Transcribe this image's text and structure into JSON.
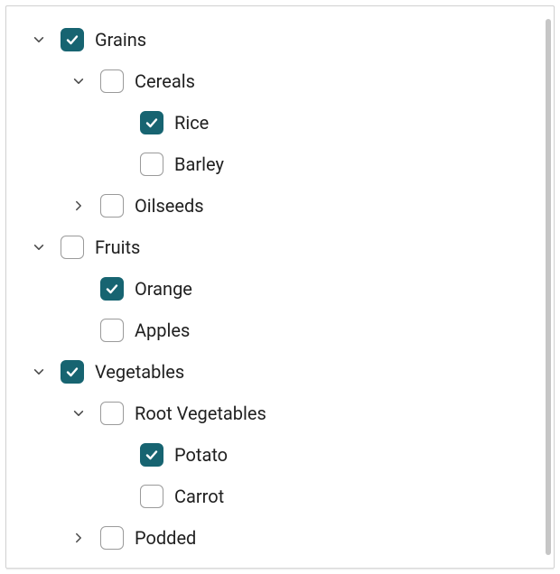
{
  "colors": {
    "accent": "#176471",
    "border": "#d0d0d0",
    "checkbox_border": "#9a9a9a"
  },
  "tree": [
    {
      "id": "grains",
      "label": "Grains",
      "checked": true,
      "expanded": true,
      "children": [
        {
          "id": "cereals",
          "label": "Cereals",
          "checked": false,
          "expanded": true,
          "children": [
            {
              "id": "rice",
              "label": "Rice",
              "checked": true
            },
            {
              "id": "barley",
              "label": "Barley",
              "checked": false
            }
          ]
        },
        {
          "id": "oilseeds",
          "label": "Oilseeds",
          "checked": false,
          "expanded": false,
          "children": []
        }
      ]
    },
    {
      "id": "fruits",
      "label": "Fruits",
      "checked": false,
      "expanded": true,
      "children": [
        {
          "id": "orange",
          "label": "Orange",
          "checked": true
        },
        {
          "id": "apples",
          "label": "Apples",
          "checked": false
        }
      ]
    },
    {
      "id": "vegetables",
      "label": "Vegetables",
      "checked": true,
      "expanded": true,
      "children": [
        {
          "id": "root-vegetables",
          "label": "Root Vegetables",
          "checked": false,
          "expanded": true,
          "children": [
            {
              "id": "potato",
              "label": "Potato",
              "checked": true
            },
            {
              "id": "carrot",
              "label": "Carrot",
              "checked": false
            }
          ]
        },
        {
          "id": "podded",
          "label": "Podded",
          "checked": false,
          "expanded": false,
          "children": []
        }
      ]
    }
  ]
}
